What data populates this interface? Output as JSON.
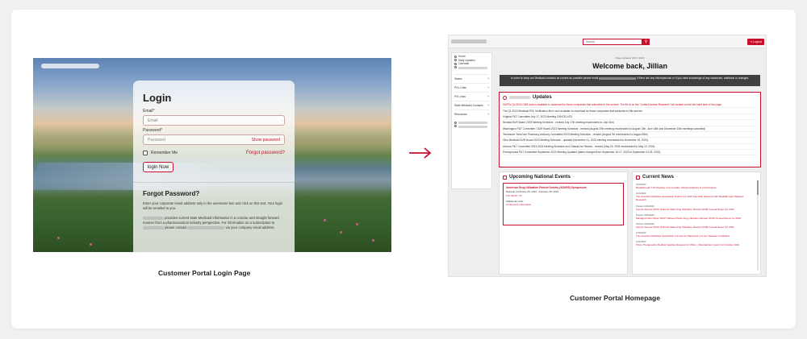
{
  "login": {
    "title": "Login",
    "email_label": "Email*",
    "email_placeholder": "Email",
    "password_label": "Password*",
    "password_placeholder": "Password",
    "show_password": "Show password",
    "remember_me": "Remember Me",
    "forgot_link": "Forgot password?",
    "login_button": "login Now",
    "forgot_title": "Forgot Password?",
    "forgot_text": "Enter your corporate email address only in the username box and click on this text. Your login will be emailed to you.",
    "about_a": "provides current state Medicaid information in a concise and straight forward manner from a pharmaceutical industry perspective. For information on a subscription to",
    "about_b": "please contact",
    "about_c": "via your company email address"
  },
  "captions": {
    "login": "Customer Portal Login Page",
    "home": "Customer Portal Homepage"
  },
  "home": {
    "search_placeholder": "Search",
    "logout": "Logout",
    "sidebar": {
      "items": [
        "Home",
        "Daily Updates",
        "Calendar"
      ],
      "groups": [
        "States",
        "PDL Links",
        "P/S Links",
        "State Medicaid Contacts",
        "Resources"
      ]
    },
    "last_updated": "Page Updated: 08.17.2023",
    "welcome": "Welcome back, Jillian",
    "notice_a": "In order to keep our Medicaid contacts as current as possible please email",
    "notice_b": "if there are any discrepancies or if you have knowledge of any vacancies, additions or changes.",
    "updates_title": "Updates",
    "updates": [
      {
        "text": "SUPRx Q4 2016 CMS data is available to download for those companies that subscribe to the service. The file is on the \"Limited Access Research\" tab located on the left-hand side of the page.",
        "red": true
      },
      {
        "text": "The Q1 2023 Medicaid PDL Verification file is now available to download for those companies that subscribe to this service",
        "red": false
      },
      {
        "text": "Virginia P&T Committee July 17, 2023 Meeting CANCELLED",
        "red": false
      },
      {
        "text": "Nevada DUR Board 2023 Meeting Schedule - revised July 17th meeting rescheduled to July 31st)",
        "red": false
      },
      {
        "text": "Washington P&T Committee / DUR Board 2023 Meeting Schedule - revised (August 20th meeting rescheduled to August 13th, June 18th and December 10th meetings cancelled)",
        "red": false
      },
      {
        "text": "Tennessee TennCare Pharmacy Advisory Committee 2023 Meeting Schedule - revised (August 7th rescheduled to August 28th)",
        "red": false
      },
      {
        "text": "Ohio Medicaid DUR Board 2023 Meeting Schedule - updated (November 11, 2023 meeting rescheduled to November 18, 2023)",
        "red": false
      },
      {
        "text": "Arizona P&T Committee 2023-2024 Meeting Schedule and Classes for Review - revised (May 20, 2024 rescheduled to May 19, 2024)",
        "red": false
      },
      {
        "text": "Pennsylvania P&T Committee September 2023 Meeting Updated (dates changed from September 16-17, 2023 to September 24-25, 2023)",
        "red": false
      }
    ],
    "events_title": "Upcoming National Events",
    "event": {
      "title": "American Drug Utilization Review Society (ADURS) Symposium",
      "date": "National | February 26, 2024 - February 28, 2024",
      "location": "Fort Worth, TX",
      "links_label": "Additional Links:",
      "links_value": "Conference Information"
    },
    "news_title": "Current News",
    "news": [
      {
        "date": "4/13/2023",
        "title": "Breakthrough T1D Meeting: now a reality. Clinical adoption of cell therapies"
      },
      {
        "date": "4/10/2023",
        "title": "The American Diabetes Association Debuts the 2023 Scientific Sessions with Breakthrough Diabetes Research"
      },
      {
        "date": "Posted: 3/29/2023",
        "title": "Fee-for-Service (FFS) National State Drug Utilization Review (DUR) Annual Report for 2022"
      },
      {
        "date": "Posted: 3/29/2023",
        "title": "Managed Care Plans (MCP) National State Drug Utilization Review (DUR) Annual Report for 2022"
      },
      {
        "date": "Posted: 3/29/2023",
        "title": "Fee-for-Service (FFS) National State Drug Utilization Review (DUR) Annual Report for 2021"
      },
      {
        "date": "1/20/2023",
        "title": "The American Diabetes Association Announces Statement on Liver Disease in Diabetes"
      },
      {
        "date": "1/23/2023",
        "title": "Prime Therapeutics Medical Supplies Request for Offers - Manufacturer Letter Oct October 2022"
      }
    ]
  }
}
